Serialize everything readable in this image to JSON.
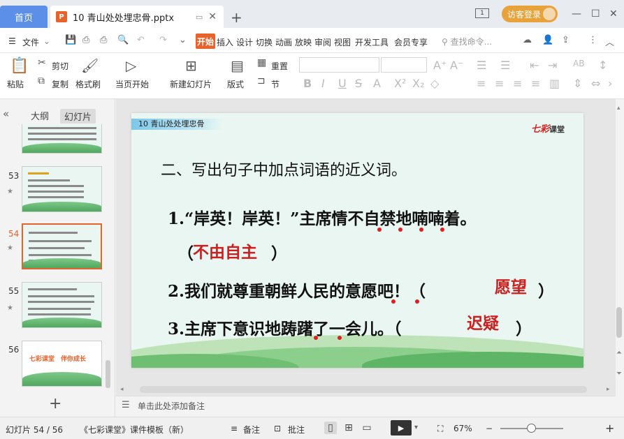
{
  "titlebar": {
    "home_tab": "首页",
    "doc_tab": "10 青山处处埋忠骨.pptx",
    "doc_icon": "P",
    "window_count": "1",
    "login": "访客登录",
    "new_tab": "+"
  },
  "menu": {
    "file": "文件",
    "items": [
      "开始",
      "插入",
      "设计",
      "切换",
      "动画",
      "放映",
      "审阅",
      "视图",
      "开发工具",
      "会员专享"
    ],
    "search_placeholder": "查找命令..."
  },
  "ribbon": {
    "paste": "粘贴",
    "cut": "剪切",
    "copy": "复制",
    "format_painter": "格式刷",
    "from_current": "当页开始",
    "new_slide": "新建幻灯片",
    "layout": "版式",
    "reset": "重置",
    "section": "节"
  },
  "left_panel": {
    "tab_outline": "大纲",
    "tab_slides": "幻灯片",
    "slide_numbers": [
      "53",
      "54",
      "55",
      "56"
    ],
    "thumb56_text": "七彩课堂　伴你成长"
  },
  "slide": {
    "tag": "10  青山处处埋忠骨",
    "logo": "七彩",
    "logo_sub": "课堂",
    "heading": "二、写出句子中加点词语的近义词。",
    "q1": "1.“岸英！岸英！”主席情不自禁地喃喃着。",
    "a1_open": "（",
    "a1": "不由自主",
    "a1_close": "）",
    "q2": "2.我们就尊重朝鲜人民的意愿吧！（",
    "a2": "愿望",
    "q2_close": "）",
    "q3": "3.主席下意识地踌躇了一会儿。（",
    "a3": "迟疑",
    "q3_close": "）"
  },
  "notes": {
    "placeholder": "单击此处添加备注"
  },
  "status": {
    "slide_counter": "幻灯片 54 / 56",
    "template": "《七彩课堂》课件模板（新）",
    "notes_btn": "备注",
    "comment_btn": "批注",
    "zoom": "67%"
  },
  "colors": {
    "accent": "#e8632c",
    "home_tab": "#5b8fe8",
    "answer_red": "#cc1f1f",
    "login": "#e8a23a"
  }
}
